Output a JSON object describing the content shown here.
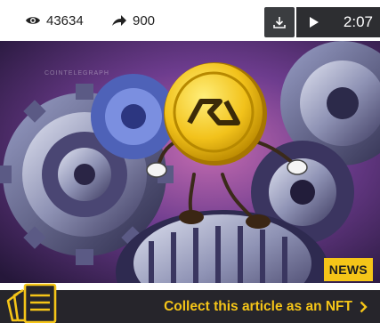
{
  "stats": {
    "views_icon": "eye-icon",
    "views": "43634",
    "shares_icon": "share-arrow-icon",
    "shares": "900"
  },
  "player": {
    "download_icon": "download-icon",
    "play_icon": "play-icon",
    "duration": "2:07"
  },
  "hero": {
    "watermark": "COINTELEGRAPH",
    "badge": "NEWS"
  },
  "cta": {
    "icon": "nft-cards-icon",
    "label": "Collect this article as an NFT",
    "chevron_icon": "chevron-right-icon"
  },
  "colors": {
    "accent": "#f5c518",
    "bar": "#26252b"
  }
}
